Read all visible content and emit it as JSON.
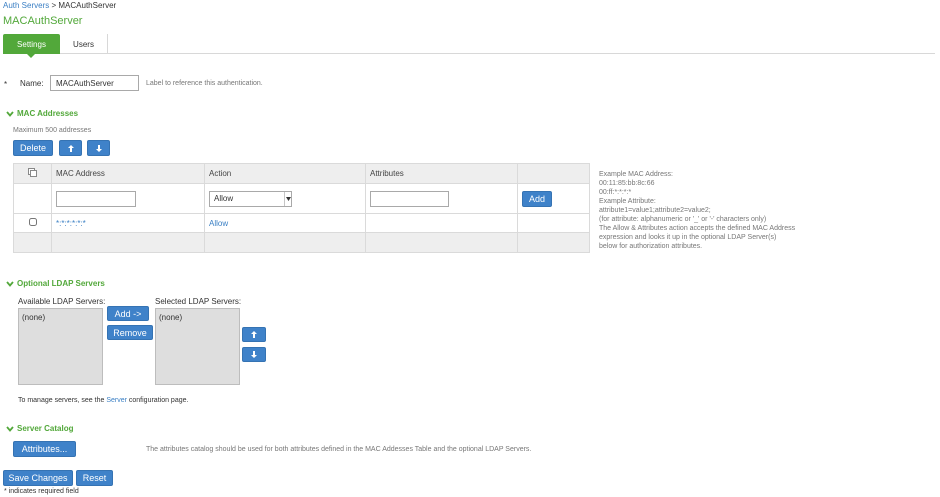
{
  "breadcrumb": {
    "parent": "Auth Servers",
    "separator": ">",
    "current": "MACAuthServer"
  },
  "page_title": "MACAuthServer",
  "tabs": [
    {
      "label": "Settings",
      "active": true
    },
    {
      "label": "Users",
      "active": false
    }
  ],
  "name_field": {
    "required_marker": "*",
    "label": "Name:",
    "value": "MACAuthServer",
    "hint": "Label to reference this authentication."
  },
  "mac_section": {
    "title": "MAC Addresses",
    "max_note": "Maximum 500 addresses",
    "delete_label": "Delete",
    "table": {
      "headers": [
        "MAC Address",
        "Action",
        "Attributes"
      ],
      "new_row": {
        "mac_value": "",
        "action_selected": "Allow",
        "attributes_value": "",
        "add_label": "Add"
      },
      "rows": [
        {
          "mac": "*:*:*:*:*:*",
          "action": "Allow",
          "attributes": ""
        }
      ]
    },
    "help_lines": [
      "Example MAC Address:",
      "00:11:85:bb:8c:66",
      "00:ff:*:*:*:*",
      "Example Attribute:",
      "attribute1=value1;attribute2=value2;",
      "(for attribute: alphanumeric or '_' or '-' characters only)",
      "The Allow & Attributes action accepts the defined MAC Address",
      "expression and looks it up in the optional LDAP Server(s)",
      "below for authorization attributes."
    ]
  },
  "ldap_section": {
    "title": "Optional LDAP Servers",
    "available_label": "Available LDAP Servers:",
    "available_items": [
      "(none)"
    ],
    "selected_label": "Selected LDAP Servers:",
    "selected_items": [
      "(none)"
    ],
    "add_label": "Add ->",
    "remove_label": "Remove",
    "manage_prefix": "To manage servers, see the ",
    "manage_link": "Server",
    "manage_suffix": " configuration page."
  },
  "catalog_section": {
    "title": "Server Catalog",
    "button_label": "Attributes...",
    "note": "The attributes catalog should be used for both attributes defined in the MAC Addesses Table and the optional LDAP Servers."
  },
  "footer": {
    "save_label": "Save Changes",
    "reset_label": "Reset",
    "required_note": "* indicates required field"
  },
  "colors": {
    "accent_green": "#52a83a",
    "button_blue": "#3f82c9",
    "link_blue": "#3a7fc4"
  }
}
